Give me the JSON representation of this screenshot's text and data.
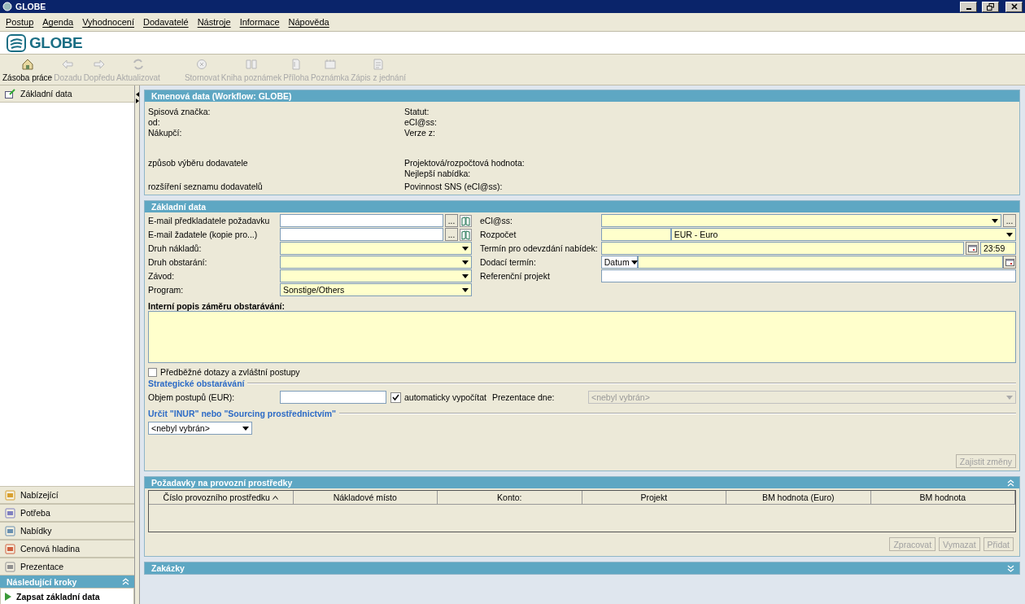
{
  "window": {
    "title": "GLOBE"
  },
  "menu": [
    "Postup",
    "Agenda",
    "Vyhodnocení",
    "Dodavatelé",
    "Nástroje",
    "Informace",
    "Nápověda"
  ],
  "logo": {
    "text": "GLOBE"
  },
  "toolbar": [
    {
      "label": "Zásoba práce",
      "disabled": false
    },
    {
      "label": "Dozadu",
      "disabled": true
    },
    {
      "label": "Dopředu",
      "disabled": true
    },
    {
      "label": "Aktualizovat",
      "disabled": true
    },
    {
      "label": "Stornovat",
      "disabled": true
    },
    {
      "label": "Kniha poznámek",
      "disabled": true
    },
    {
      "label": "Příloha",
      "disabled": true
    },
    {
      "label": "Poznámka",
      "disabled": true
    },
    {
      "label": "Zápis z jednání",
      "disabled": true
    }
  ],
  "sidebar": {
    "top_items": [
      {
        "label": "Základní data"
      }
    ],
    "nav_items": [
      {
        "label": "Nabízející"
      },
      {
        "label": "Potřeba"
      },
      {
        "label": "Nabídky"
      },
      {
        "label": "Cenová hladina"
      },
      {
        "label": "Prezentace"
      }
    ],
    "next_steps": {
      "title": "Následující kroky",
      "expanded": true,
      "items": [
        {
          "label": "Zapsat základní data"
        }
      ]
    }
  },
  "master_data": {
    "title": "Kmenová data (Workflow: GLOBE)",
    "rows": [
      {
        "left": "Spisová značka:",
        "right": "Statut:"
      },
      {
        "left": "od:",
        "right": "eCl@ss:"
      },
      {
        "left": "Nákupčí:",
        "right": "Verze z:"
      },
      {
        "left": "způsob výběru dodavatele",
        "right": "Projektová/rozpočtová hodnota:"
      },
      {
        "right": "Nejlepší nabídka:"
      },
      {
        "left": "rozšíření seznamu dodavatelů",
        "right": "Povinnost SNS (eCl@ss):"
      }
    ]
  },
  "basic_data": {
    "title": "Základní data",
    "left_fields": [
      {
        "label": "E-mail předkladatele požadavku",
        "kind": "lookup",
        "required": false,
        "browse": "..."
      },
      {
        "label": "E-mail žadatele (kopie pro...)",
        "kind": "lookup",
        "required": false,
        "browse": "..."
      },
      {
        "label": "Druh nákladů:",
        "kind": "select",
        "required": true
      },
      {
        "label": "Druh obstarání:",
        "kind": "select",
        "required": true
      },
      {
        "label": "Závod:",
        "kind": "select",
        "required": true
      },
      {
        "label": "Program:",
        "kind": "select",
        "required": true,
        "value": "Sonstige/Others"
      }
    ],
    "right_fields": [
      {
        "label": "eCl@ss:",
        "kind": "select_browse",
        "required": true,
        "browse": "..."
      },
      {
        "label": "Rozpočet",
        "kind": "amount_currency",
        "required": true,
        "value": "EUR - Euro"
      },
      {
        "label": "Termín pro odevzdání nabídek:",
        "kind": "datetime",
        "required": true,
        "value": "23:59"
      },
      {
        "label": "Dodací termín:",
        "kind": "date_mode",
        "required": true,
        "value": "Datum"
      },
      {
        "label": "Referenční projekt",
        "kind": "text",
        "required": false
      }
    ],
    "description": {
      "label": "Interní popis záměru obstarávání:",
      "required": true
    },
    "preliminary": {
      "label": "Předběžné dotazy a zvláštní postupy",
      "checked": false
    },
    "strategic": {
      "title": "Strategické obstarávání",
      "volume_label": "Objem postupů (EUR):",
      "auto": {
        "label": "automaticky vypočítat",
        "checked": true
      },
      "presentation_label": "Prezentace dne:",
      "presentation_value": "<nebyl vybrán>",
      "presentation_disabled": true
    },
    "inur": {
      "title": "Určit \"INUR\" nebo \"Sourcing prostřednictvím\"",
      "value": "<nebyl vybrán>"
    },
    "save_button": {
      "label": "Zajistit změny",
      "disabled": true
    }
  },
  "requirements": {
    "title": "Požadavky na provozní prostředky",
    "expanded": true,
    "columns": [
      {
        "label": "Číslo provozního prostředku",
        "sorted": true
      },
      {
        "label": "Nákladové místo",
        "sorted": false
      },
      {
        "label": "Konto:",
        "sorted": false
      },
      {
        "label": "Projekt",
        "sorted": false
      },
      {
        "label": "BM hodnota (Euro)",
        "sorted": false
      },
      {
        "label": "BM hodnota",
        "sorted": false
      }
    ],
    "buttons": [
      {
        "label": "Zpracovat",
        "disabled": true
      },
      {
        "label": "Vymazat",
        "disabled": true
      },
      {
        "label": "Přidat",
        "disabled": true
      }
    ]
  },
  "orders": {
    "title": "Zakázky",
    "expanded": false
  }
}
